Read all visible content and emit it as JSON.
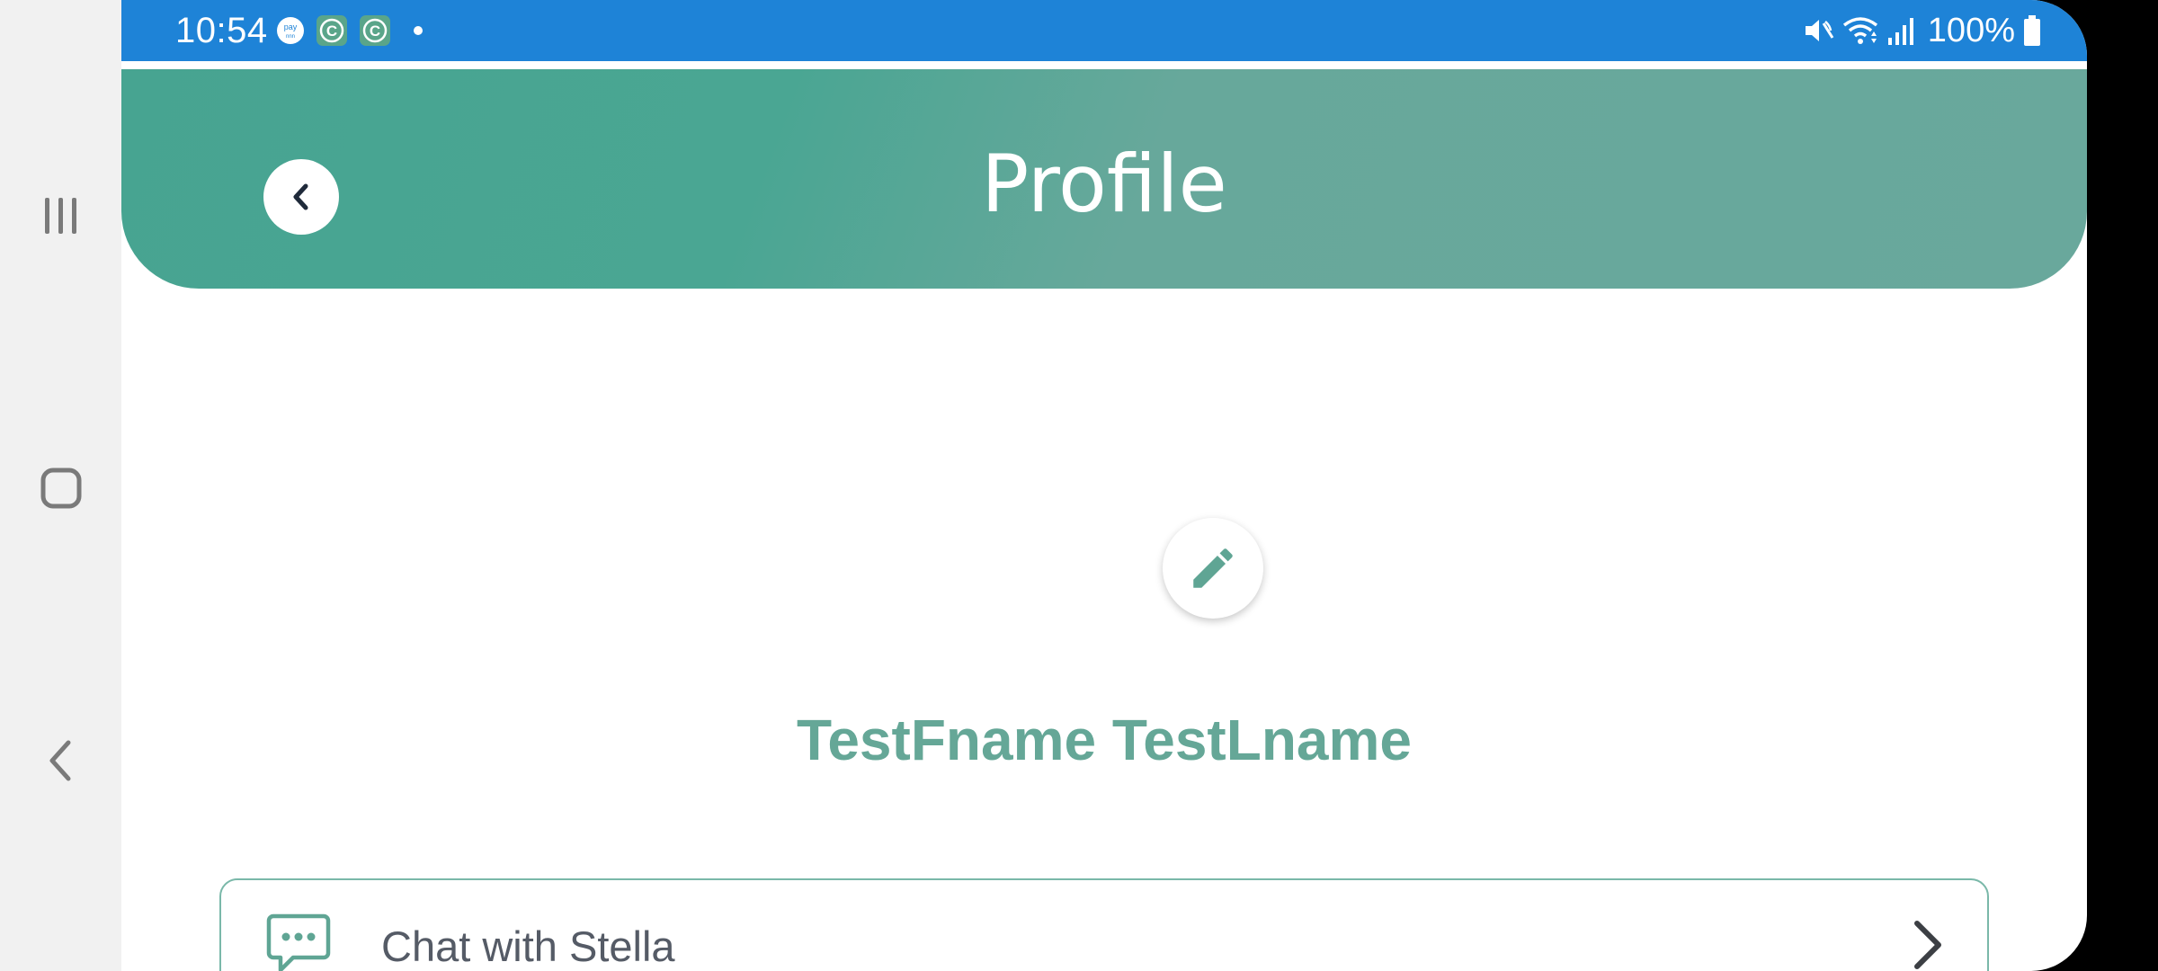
{
  "status_bar": {
    "time": "10:54",
    "notification_icons": [
      "pay-icon",
      "c-app-icon",
      "c-app-icon",
      "dot-icon"
    ],
    "battery": "100%",
    "color": "#1e83d7"
  },
  "header": {
    "title": "Profile",
    "color": "#4aa693"
  },
  "profile": {
    "name": "TestFname TestLname"
  },
  "menu": {
    "items": [
      {
        "label": "Chat with Stella",
        "icon": "chat-bubble-icon"
      }
    ]
  },
  "system_nav": {
    "items": [
      "recent-apps",
      "home",
      "back"
    ]
  }
}
